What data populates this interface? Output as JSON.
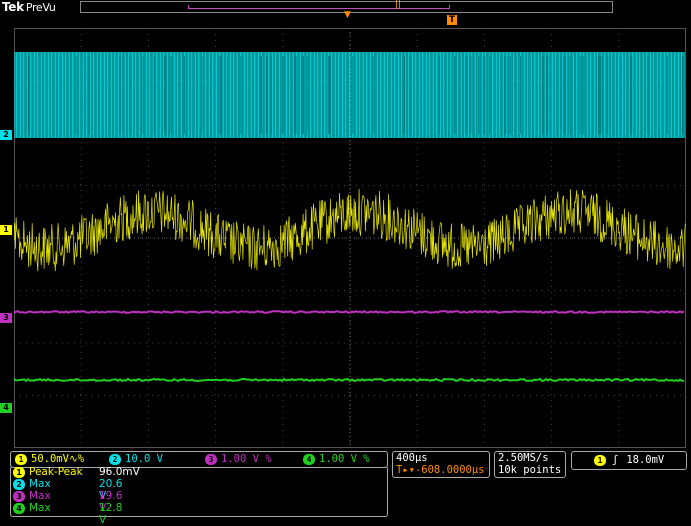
{
  "header": {
    "brand": "Tek",
    "status": "PreVu",
    "record_marker": "||",
    "trigger_position_marker": "▼",
    "trigger_marker": "T"
  },
  "channels": [
    {
      "id": "1",
      "color": "#ffff00",
      "label": "1",
      "scale": "50.0mV",
      "coupling_suffix": "∿%"
    },
    {
      "id": "2",
      "color": "#00e0e8",
      "label": "2",
      "scale": "10.0 V",
      "coupling_suffix": ""
    },
    {
      "id": "3",
      "color": "#c030c0",
      "label": "3",
      "scale": "1.00 V",
      "coupling_suffix": "%"
    },
    {
      "id": "4",
      "color": "#20d020",
      "label": "4",
      "scale": "1.00 V",
      "coupling_suffix": "%"
    }
  ],
  "timebase": {
    "scale": "400µs",
    "offset": "-608.0000µs",
    "offset_prefix": "T▸▾"
  },
  "acquisition": {
    "sample_rate": "2.50MS/s",
    "record_length": "10k points"
  },
  "trigger": {
    "source": "1",
    "slope_symbol": "ʃ",
    "level": "18.0mV"
  },
  "measurements": [
    {
      "channel": "1",
      "name": "Peak-Peak",
      "value": "96.0mV",
      "color": "#ffff00"
    },
    {
      "channel": "2",
      "name": "Max",
      "value": "20.6 V",
      "color": "#00e0e8"
    },
    {
      "channel": "3",
      "name": "Max",
      "value": "19.6 V",
      "color": "#c030c0"
    },
    {
      "channel": "4",
      "name": "Max",
      "value": "12.8 V",
      "color": "#20d020"
    }
  ]
}
